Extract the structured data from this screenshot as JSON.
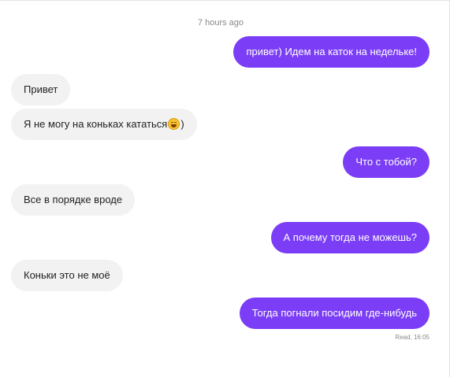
{
  "conversation": {
    "time_divider": "7 hours ago",
    "messages": [
      {
        "direction": "outgoing",
        "text": "привет) Идем на каток на недельке!"
      },
      {
        "direction": "incoming",
        "text": "Привет"
      },
      {
        "direction": "incoming",
        "text_before": "Я не могу на коньках кататься",
        "emoji": "grinning-face-emoji",
        "text_after": ")"
      },
      {
        "direction": "outgoing",
        "text": "Что с тобой?"
      },
      {
        "direction": "incoming",
        "text": "Все в порядке вроде"
      },
      {
        "direction": "outgoing",
        "text": "А почему тогда не можешь?"
      },
      {
        "direction": "incoming",
        "text": "Коньки это не моё"
      },
      {
        "direction": "outgoing",
        "text": "Тогда погнали посидим где-нибудь"
      }
    ],
    "read_receipt": "Read, 16:05"
  },
  "colors": {
    "outgoing_bubble": "#7b3df6",
    "incoming_bubble": "#f2f2f2",
    "meta_text": "#8a8a8a"
  }
}
